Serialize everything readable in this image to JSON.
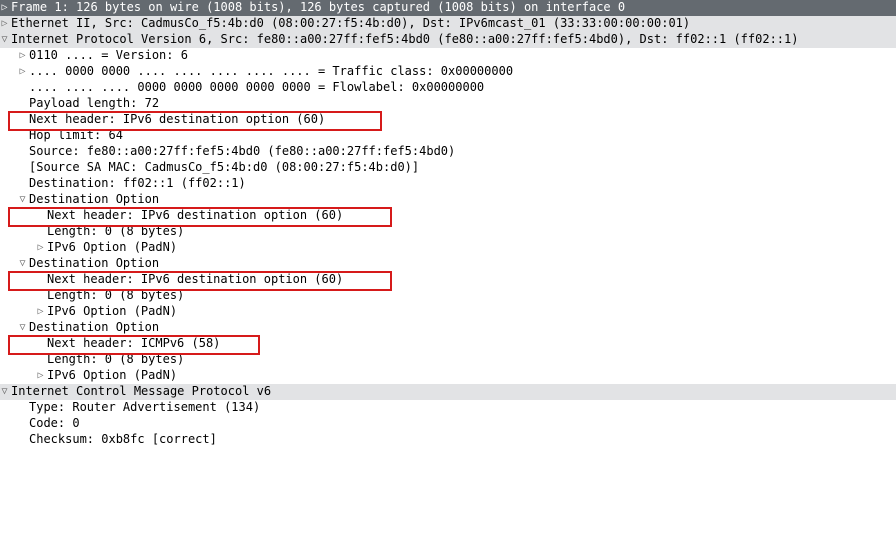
{
  "frame": {
    "summary": "Frame 1: 126 bytes on wire (1008 bits), 126 bytes captured (1008 bits) on interface 0"
  },
  "ethernet": {
    "summary": "Ethernet II, Src: CadmusCo_f5:4b:d0 (08:00:27:f5:4b:d0), Dst: IPv6mcast_01 (33:33:00:00:00:01)"
  },
  "ipv6": {
    "summary": "Internet Protocol Version 6, Src: fe80::a00:27ff:fef5:4bd0 (fe80::a00:27ff:fef5:4bd0), Dst: ff02::1 (ff02::1)",
    "version": "0110 .... = Version: 6",
    "tclass": ".... 0000 0000 .... .... .... .... .... = Traffic class: 0x00000000",
    "flowlabel": ".... .... .... 0000 0000 0000 0000 0000 = Flowlabel: 0x00000000",
    "payload_length": "Payload length: 72",
    "next_header": "Next header: IPv6 destination option (60)",
    "hop_limit": "Hop limit: 64",
    "source": "Source: fe80::a00:27ff:fef5:4bd0 (fe80::a00:27ff:fef5:4bd0)",
    "source_sa_mac": "[Source SA MAC: CadmusCo_f5:4b:d0 (08:00:27:f5:4b:d0)]",
    "destination": "Destination: ff02::1 (ff02::1)"
  },
  "destopt": [
    {
      "title": "Destination Option",
      "next_header": "Next header: IPv6 destination option (60)",
      "length": "Length: 0 (8 bytes)",
      "option": "IPv6 Option (PadN)"
    },
    {
      "title": "Destination Option",
      "next_header": "Next header: IPv6 destination option (60)",
      "length": "Length: 0 (8 bytes)",
      "option": "IPv6 Option (PadN)"
    },
    {
      "title": "Destination Option",
      "next_header": "Next header: ICMPv6 (58)",
      "length": "Length: 0 (8 bytes)",
      "option": "IPv6 Option (PadN)"
    }
  ],
  "icmpv6": {
    "title": "Internet Control Message Protocol v6",
    "type": "Type: Router Advertisement (134)",
    "code": "Code: 0",
    "checksum": "Checksum: 0xb8fc [correct]"
  }
}
